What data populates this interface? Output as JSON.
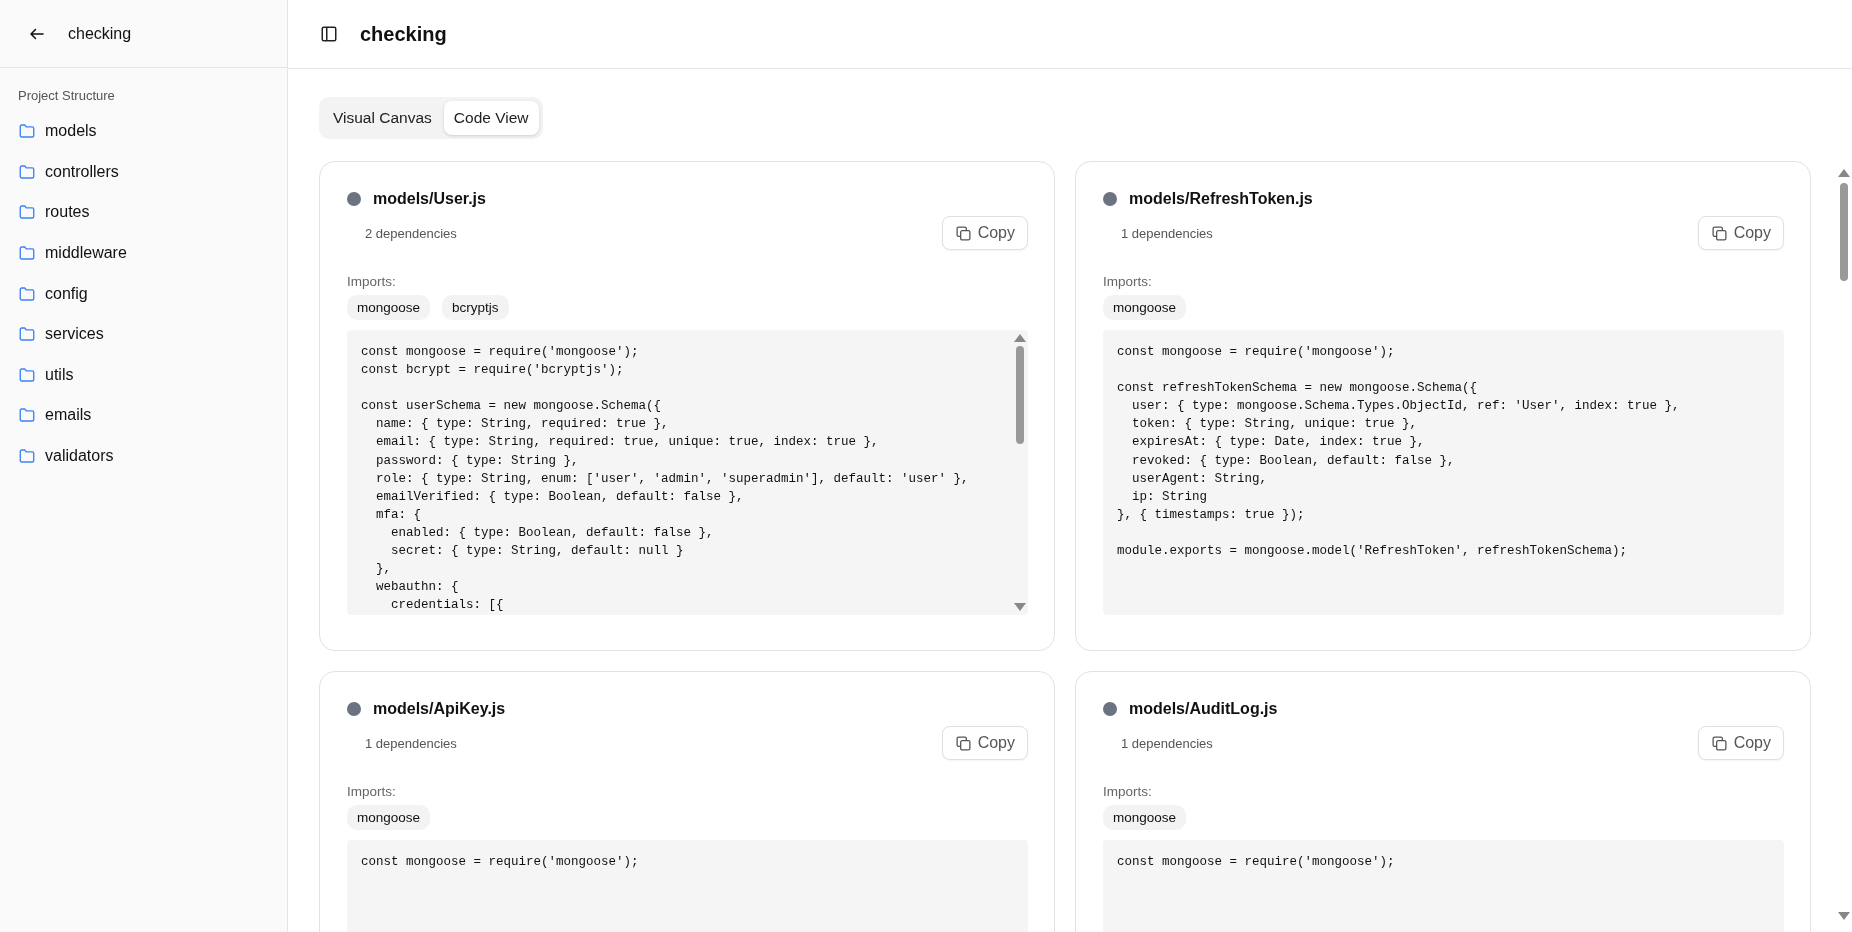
{
  "sidebar": {
    "back_title": "checking",
    "section_label": "Project Structure",
    "folders": [
      {
        "name": "models"
      },
      {
        "name": "controllers"
      },
      {
        "name": "routes"
      },
      {
        "name": "middleware"
      },
      {
        "name": "config"
      },
      {
        "name": "services"
      },
      {
        "name": "utils"
      },
      {
        "name": "emails"
      },
      {
        "name": "validators"
      }
    ]
  },
  "header": {
    "title": "checking"
  },
  "tabs": [
    {
      "label": "Visual Canvas",
      "selected": false
    },
    {
      "label": "Code View",
      "selected": true
    }
  ],
  "cards": [
    {
      "path": "models/User.js",
      "dependencies": "2 dependencies",
      "copy_label": "Copy",
      "imports_label": "Imports:",
      "imports": [
        "mongoose",
        "bcryptjs"
      ],
      "code": "const mongoose = require('mongoose');\nconst bcrypt = require('bcryptjs');\n\nconst userSchema = new mongoose.Schema({\n  name: { type: String, required: true },\n  email: { type: String, required: true, unique: true, index: true },\n  password: { type: String },\n  role: { type: String, enum: ['user', 'admin', 'superadmin'], default: 'user' },\n  emailVerified: { type: Boolean, default: false },\n  mfa: {\n    enabled: { type: Boolean, default: false },\n    secret: { type: String, default: null }\n  },\n  webauthn: {\n    credentials: [{",
      "code_scrollable": true
    },
    {
      "path": "models/RefreshToken.js",
      "dependencies": "1 dependencies",
      "copy_label": "Copy",
      "imports_label": "Imports:",
      "imports": [
        "mongoose"
      ],
      "code": "const mongoose = require('mongoose');\n\nconst refreshTokenSchema = new mongoose.Schema({\n  user: { type: mongoose.Schema.Types.ObjectId, ref: 'User', index: true },\n  token: { type: String, unique: true },\n  expiresAt: { type: Date, index: true },\n  revoked: { type: Boolean, default: false },\n  userAgent: String,\n  ip: String\n}, { timestamps: true });\n\nmodule.exports = mongoose.model('RefreshToken', refreshTokenSchema);",
      "code_scrollable": false
    },
    {
      "path": "models/ApiKey.js",
      "dependencies": "1 dependencies",
      "copy_label": "Copy",
      "imports_label": "Imports:",
      "imports": [
        "mongoose"
      ],
      "code": "const mongoose = require('mongoose');",
      "code_scrollable": false
    },
    {
      "path": "models/AuditLog.js",
      "dependencies": "1 dependencies",
      "copy_label": "Copy",
      "imports_label": "Imports:",
      "imports": [
        "mongoose"
      ],
      "code": "const mongoose = require('mongoose');",
      "code_scrollable": false
    }
  ]
}
